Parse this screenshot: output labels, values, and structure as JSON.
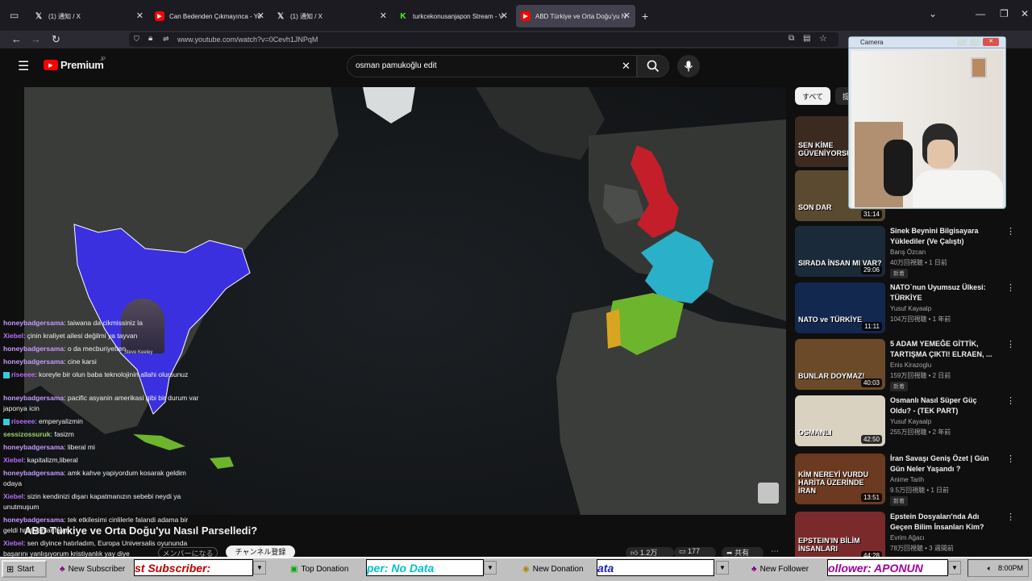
{
  "tabs": [
    {
      "title": "(1) 通知 / X",
      "icon": "x-icon"
    },
    {
      "title": "Can Bedenden Çıkmayınca - Yo",
      "icon": "youtube-icon"
    },
    {
      "title": "(1) 通知 / X",
      "icon": "x-icon"
    },
    {
      "title": "turkcekonusanjapon Stream - V",
      "icon": "kick-icon"
    },
    {
      "title": "ABD Türkiye ve Orta Doğu'yu N",
      "icon": "youtube-icon"
    }
  ],
  "url": "www.youtube.com/watch?v=0Cevh1JNPqM",
  "youtube": {
    "logo": "Premium",
    "logo_sup": "JP",
    "search_value": "osman pamukoğlu edit"
  },
  "video": {
    "title": "ABD Türkiye ve Orta Doğu'yu Nasıl Parselledi?",
    "member_btn": "メンバーになる",
    "subscribe_btn": "チャンネル登録",
    "likes": "1.2万",
    "comments": "177",
    "share": "共有",
    "overlay_name": "Steve Keeley"
  },
  "chips": [
    "すべて",
    "提"
  ],
  "recommended": [
    {
      "title": "",
      "channel": "",
      "meta": "",
      "duration": "",
      "thumb_text": "SEN KİME GÜVENİYORSUN",
      "thumb_color": "#3a2a20"
    },
    {
      "title": "",
      "channel": "",
      "meta": "",
      "duration": "31:14",
      "thumb_text": "SON DAR",
      "thumb_color": "#5a4a30"
    },
    {
      "title": "Sinek Beynini Bilgisayara Yüklediler (Ve Çalıştı)",
      "channel": "Barış Özcan",
      "meta": "40万回視聴 • 1 日前",
      "badge": "新着",
      "duration": "29:06",
      "thumb_text": "SIRADA İNSAN MI VAR?",
      "thumb_color": "#1b2a38"
    },
    {
      "title": "NATO`nun Uyumsuz Ülkesi: TÜRKİYE",
      "channel": "Yusuf Kayaalp",
      "meta": "104万回視聴 • 1 年前",
      "duration": "11:11",
      "thumb_text": "NATO ve TÜRKİYE",
      "thumb_color": "#13284f"
    },
    {
      "title": "5 ADAM YEMEĞE GİTTİK, TARTIŞMA ÇIKTI! ELRAEN, ...",
      "channel": "Enis Kirazoglu",
      "meta": "159万回視聴 • 2 日前",
      "badge": "新着",
      "duration": "40:03",
      "thumb_text": "BUNLAR DOYMAZ!",
      "thumb_color": "#6b4a2a"
    },
    {
      "title": "Osmanlı Nasıl Süper Güç Oldu? - (TEK PART)",
      "channel": "Yusuf Kayaalp",
      "meta": "255万回視聴 • 2 年前",
      "duration": "42:50",
      "thumb_text": "OSMANLI",
      "thumb_color": "#d9d2c0"
    },
    {
      "title": "İran Savaşı Geniş Özet | Gün Gün Neler Yaşandı ?",
      "channel": "Anime Tarih",
      "meta": "9.5万回視聴 • 1 日前",
      "badge": "新着",
      "duration": "13:51",
      "thumb_text": "KİM NEREYİ VURDU HARİTA ÜZERİNDE İRAN",
      "thumb_color": "#6b3a20"
    },
    {
      "title": "Epstein Dosyaları'nda Adı Geçen Bilim İnsanları Kim?",
      "channel": "Evrim Ağacı",
      "meta": "78万回視聴 • 3 週間前",
      "duration": "44:28",
      "thumb_text": "EPSTEIN'IN BİLİM İNSANLARI",
      "thumb_color": "#7a2a2a"
    }
  ],
  "chat": [
    {
      "user": "honeybadgersama",
      "msg": "taiwana da cikmissiniz la",
      "cls": ""
    },
    {
      "user": "Xiebel",
      "msg": "çinin kraliyet ailesi değilmi ya tayvan",
      "cls": "k"
    },
    {
      "user": "honeybadgersama",
      "msg": "o da mecburiyetten",
      "cls": ""
    },
    {
      "user": "honeybadgersama",
      "msg": "cine karsi",
      "cls": ""
    },
    {
      "user": "riseeee",
      "msg": "koreyle bir olun baba teknolojinin allahi olursunuz",
      "cls": "k",
      "badge": true
    },
    {
      "user": "honeybadgersama",
      "msg": "pacific asyanin amerikasi gibi bir durum var japonya icin",
      "cls": ""
    },
    {
      "user": "riseeee",
      "msg": "emperyalizmin",
      "cls": "k",
      "badge": true
    },
    {
      "user": "sessizossuruk",
      "msg": "fasizm",
      "cls": "s"
    },
    {
      "user": "honeybadgersama",
      "msg": "liberal mi",
      "cls": ""
    },
    {
      "user": "Xiebel",
      "msg": "kapitalizm,liberal",
      "cls": "k"
    },
    {
      "user": "honeybadgersama",
      "msg": "amk kahve yapiyordum kosarak geldim odaya",
      "cls": ""
    },
    {
      "user": "Xiebel",
      "msg": "sizin kendinizi dişarı kapatmanızın sebebi neydi ya unutmuşum",
      "cls": "k"
    },
    {
      "user": "honeybadgersama",
      "msg": "tek etkilesimi cinlilerle falandi adama bir geldi hristiyanlar falan",
      "cls": ""
    },
    {
      "user": "Xiebel",
      "msg": "sen diyince hatırladım, Europa Universalis oyununda başarını yanlışıyorum kristiyanlık yay diye",
      "cls": "k"
    }
  ],
  "camera": {
    "title": "Camera"
  },
  "taskbar": {
    "start": "Start",
    "new_subscriber": "New Subscriber",
    "subscriber_field": "st Subscriber:",
    "top_donation": "Top Donation",
    "top_donation_field": "per: No Data",
    "new_donation": "New Donation",
    "new_donation_field": "ata",
    "new_follower": "New Follower",
    "follower_field": "ollower: APONUN",
    "clock": "8:00PM"
  }
}
